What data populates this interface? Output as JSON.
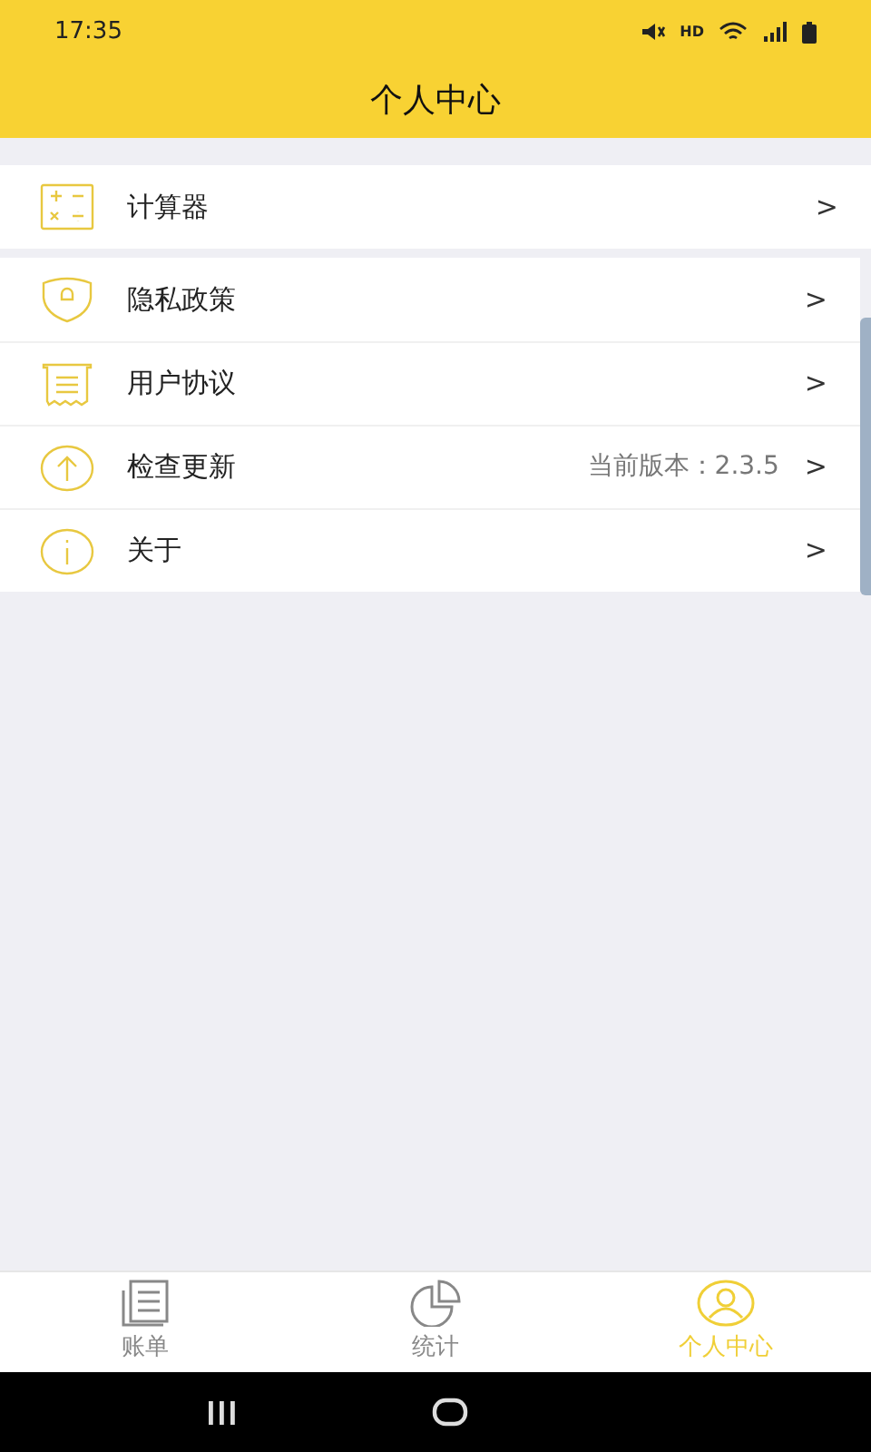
{
  "status_bar": {
    "time": "17:35",
    "indicators": "HD"
  },
  "header": {
    "title": "个人中心"
  },
  "groups": [
    {
      "items": [
        {
          "label": "计算器",
          "chevron": ">"
        }
      ]
    },
    {
      "items": [
        {
          "label": "隐私政策",
          "chevron": ">"
        },
        {
          "label": "用户协议",
          "chevron": ">"
        },
        {
          "label": "检查更新",
          "value": "当前版本：2.3.5",
          "chevron": ">"
        },
        {
          "label": "关于",
          "chevron": ">"
        }
      ]
    }
  ],
  "tab_bar": [
    {
      "label": "账单",
      "selected": false
    },
    {
      "label": "统计",
      "selected": false
    },
    {
      "label": "个人中心",
      "selected": true
    }
  ]
}
